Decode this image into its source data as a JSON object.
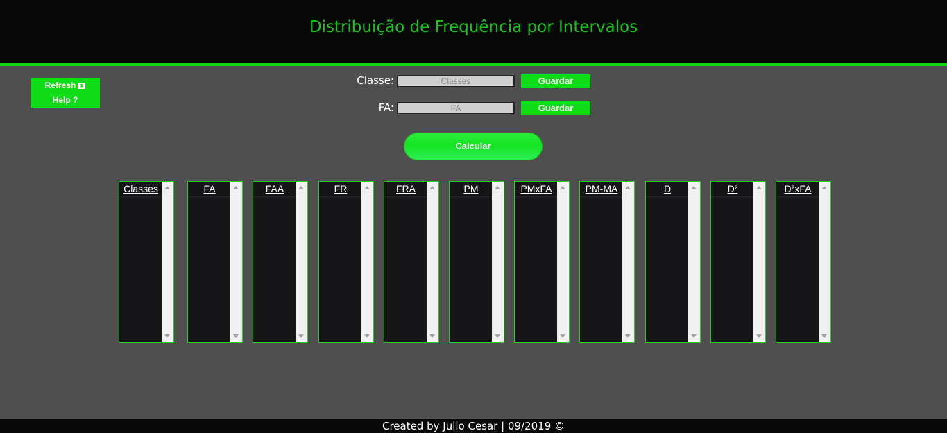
{
  "header": {
    "title": "Distribuição de Frequência por Intervalos"
  },
  "menu": {
    "refresh_label": "Refresh",
    "refresh_icon": "hourglass-icon",
    "help_label": "Help ?"
  },
  "form": {
    "classe": {
      "label": "Classe:",
      "placeholder": "Classes",
      "value": "",
      "button": "Guardar"
    },
    "fa": {
      "label": "FA:",
      "placeholder": "FA",
      "value": "",
      "button": "Guardar"
    }
  },
  "calculate_label": "Calcular",
  "columns": [
    "Classes",
    "FA",
    "FAA",
    "FR",
    "FRA",
    "PM",
    "PMxFA",
    "PM-MA",
    "D",
    "D²",
    "D²xFA"
  ],
  "colors": {
    "accent": "#16d41a",
    "background": "#504f50",
    "panel": "#161618",
    "bar": "#080808"
  },
  "footer": {
    "text": "Created by Julio Cesar | 09/2019 ©"
  }
}
